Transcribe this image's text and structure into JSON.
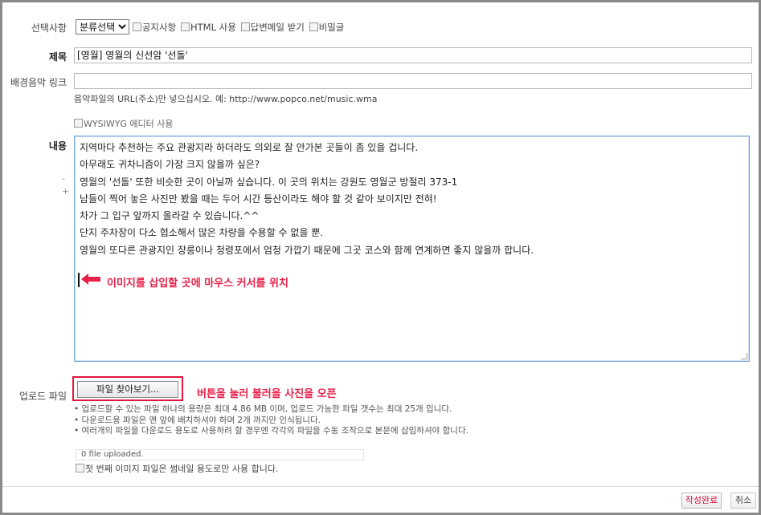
{
  "form": {
    "options": {
      "label": "선택사항",
      "category_selected": "분류선택",
      "notice": "공지사항",
      "html": "HTML 사용",
      "reply_mail": "답변메일 받기",
      "secret": "비밀글"
    },
    "subject": {
      "label": "제목",
      "value": "[영월] 영월의 신선암 '선돌'"
    },
    "bgm": {
      "label": "배경음악 링크",
      "value": "",
      "hint": "음악파일의 URL(주소)만 넣으십시오. 예: http://www.popco.net/music.wma"
    },
    "wysiwyg": {
      "label": "WYSIWYG 에디터 사용"
    },
    "content": {
      "label": "내용",
      "shrink": "-",
      "expand": "+",
      "lines": [
        "지역마다 추천하는 주요 관광지라 하더라도 의외로 잘 안가본 곳들이 좀 있을 겁니다.",
        "아무래도 귀차니즘이 가장 크지 않을까 싶은?",
        "영월의 '선돌' 또한 비슷한 곳이 아닐까 싶습니다. 이 곳의 위치는 강원도 영월군 방절리 373-1",
        "남들이 찍어 놓은 사진만 봤을 때는 두어 시간 등산이라도 해야 할 것 같아  보이지만 전혀!",
        "차가 그 입구 앞까지 올라갈 수 있습니다.^^",
        "단지 주차장이 다소 협소해서 많은 차량을 수용할 수 없을 뿐.",
        "영월의 또다른 관광지인 장릉이나 청령포에서 엄청 가깝기 때문에 그곳 코스와 함께 연계하면 좋지 않을까 합니다."
      ],
      "cursor_annotation": "이미지를 삽입할 곳에 마우스 커서를 위치"
    },
    "upload": {
      "label": "업로드 파일",
      "button": "파일 찾아보기...",
      "annotation": "버튼을 눌러 불러올 사진을 오픈",
      "notes": [
        "• 업로드할 수 있는 파일 하나의 용량은 최대 4.86 MB 이며, 업로드 가능한 파일 갯수는 최대 25개 입니다.",
        "• 다운로드용 파일은 맨 앞에 배치하셔야 하며 2개 까지만 인식됩니다.",
        "• 여러개의 파일을 다운로드 용도로 사용하려 할 경우엔 각각의 파일을 수동 조작으로 본문에 삽입하셔야 합니다."
      ],
      "status": "0 file uploaded.",
      "thumb_option": "첫 번째 이미지 파일은 썸네일 용도로만 사용 합니다."
    },
    "actions": {
      "submit": "작성완료",
      "cancel": "취소"
    }
  },
  "colors": {
    "annotation_red": "#e8214a",
    "editor_border": "#7aa7d9"
  }
}
